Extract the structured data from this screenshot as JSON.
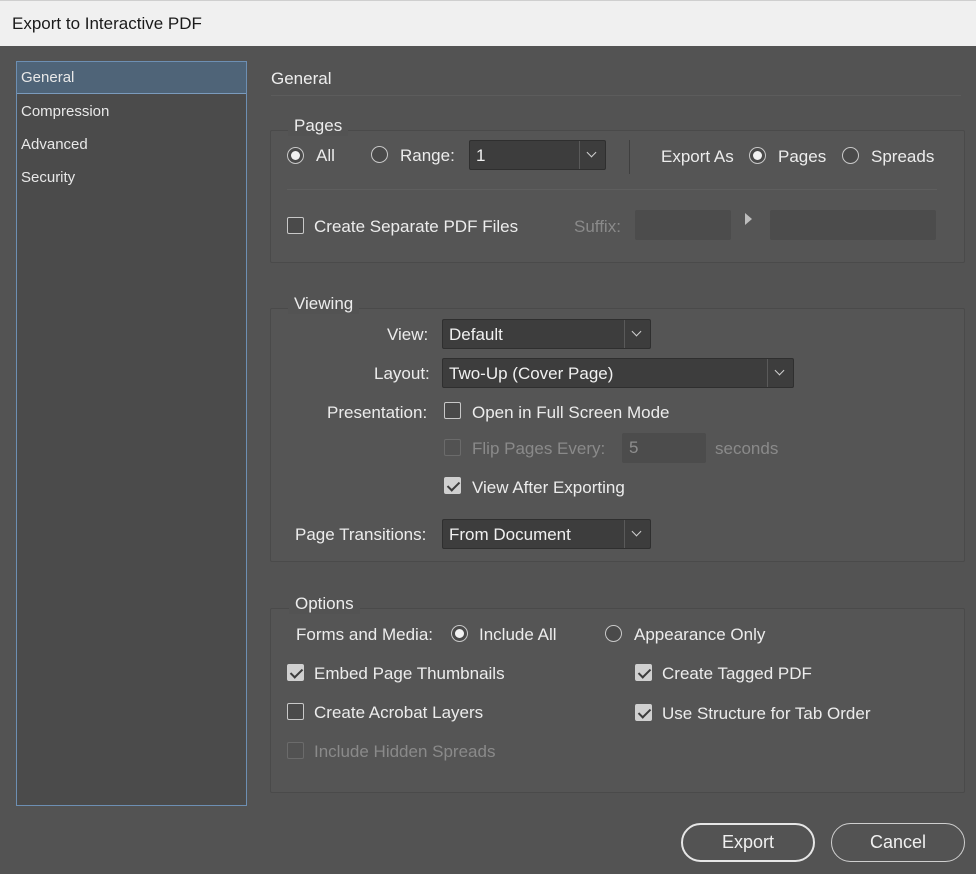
{
  "window": {
    "title": "Export to Interactive PDF"
  },
  "sidebar": {
    "items": [
      {
        "label": "General",
        "selected": true
      },
      {
        "label": "Compression",
        "selected": false
      },
      {
        "label": "Advanced",
        "selected": false
      },
      {
        "label": "Security",
        "selected": false
      }
    ]
  },
  "panel": {
    "title": "General"
  },
  "pages": {
    "title": "Pages",
    "all_label": "All",
    "all_selected": true,
    "range_label": "Range:",
    "range_value": "1",
    "export_as_label": "Export As",
    "pages_label": "Pages",
    "pages_selected": true,
    "spreads_label": "Spreads",
    "separate_label": "Create Separate PDF Files",
    "separate_checked": false,
    "suffix_label": "Suffix:"
  },
  "viewing": {
    "title": "Viewing",
    "view_label": "View:",
    "view_value": "Default",
    "layout_label": "Layout:",
    "layout_value": "Two-Up (Cover Page)",
    "presentation_label": "Presentation:",
    "fullscreen_label": "Open in Full Screen Mode",
    "fullscreen_checked": false,
    "flip_label": "Flip Pages Every:",
    "flip_value": "5",
    "seconds_label": "seconds",
    "view_after_label": "View After Exporting",
    "view_after_checked": true,
    "transitions_label": "Page Transitions:",
    "transitions_value": "From Document"
  },
  "options": {
    "title": "Options",
    "forms_label": "Forms and Media:",
    "include_all_label": "Include All",
    "include_all_selected": true,
    "appearance_label": "Appearance Only",
    "thumbnails_label": "Embed Page Thumbnails",
    "thumbnails_checked": true,
    "tagged_label": "Create Tagged PDF",
    "tagged_checked": true,
    "layers_label": "Create Acrobat Layers",
    "layers_checked": false,
    "tab_order_label": "Use Structure for Tab Order",
    "tab_order_checked": true,
    "hidden_label": "Include Hidden Spreads",
    "hidden_checked": false
  },
  "buttons": {
    "export_label": "Export",
    "cancel_label": "Cancel"
  }
}
